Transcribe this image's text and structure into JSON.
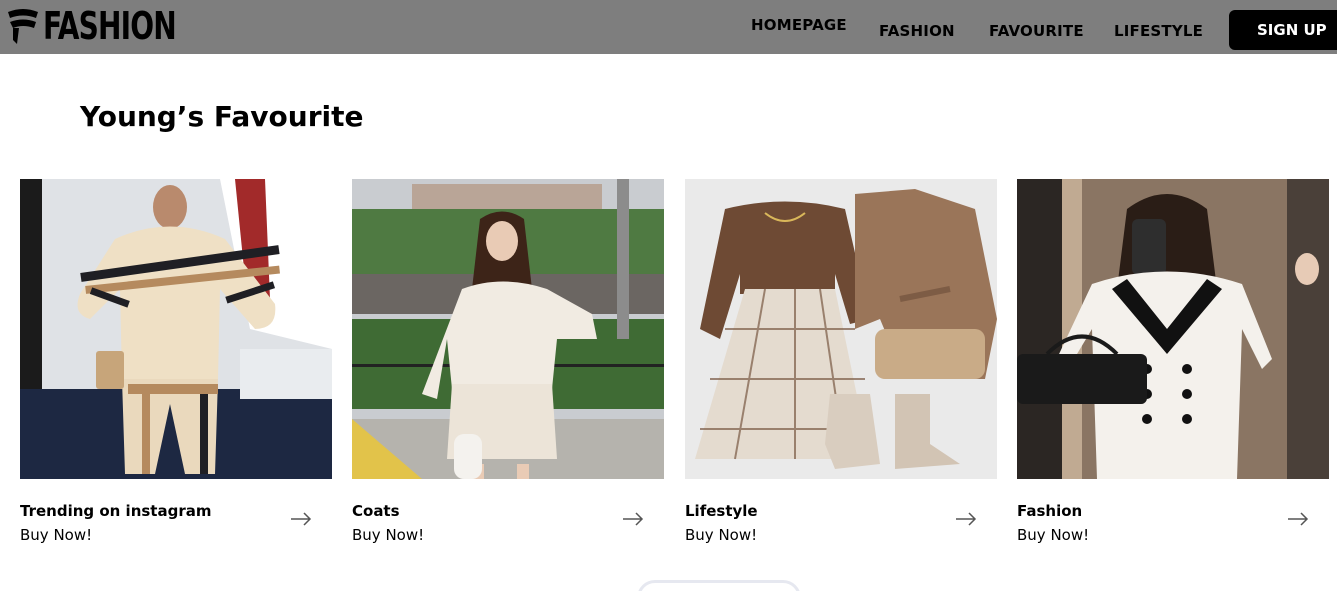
{
  "brand": {
    "name": "FASHION",
    "logo_icon": "fashion-logo-icon"
  },
  "nav": {
    "items": [
      {
        "label": "HOMEPAGE"
      },
      {
        "label": "FASHION"
      },
      {
        "label": "FAVOURITE"
      },
      {
        "label": "LIFESTYLE"
      }
    ],
    "signup_label": "SIGN UP"
  },
  "section": {
    "title": "Young’s Favourite"
  },
  "cards": [
    {
      "title": "Trending on instagram",
      "subtitle": "Buy Now!",
      "icon": "arrow-right-icon"
    },
    {
      "title": "Coats",
      "subtitle": "Buy Now!",
      "icon": "arrow-right-icon"
    },
    {
      "title": "Lifestyle",
      "subtitle": "Buy Now!",
      "icon": "arrow-right-icon"
    },
    {
      "title": "Fashion",
      "subtitle": "Buy Now!",
      "icon": "arrow-right-icon"
    }
  ],
  "colors": {
    "header_bg": "#7e7e7e",
    "button_bg": "#000000",
    "page_bg": "#ffffff"
  }
}
